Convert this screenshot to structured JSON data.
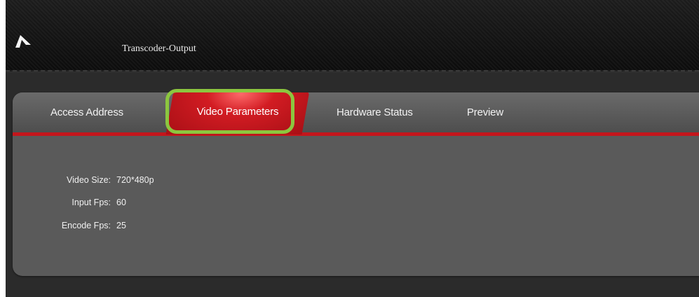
{
  "app": {
    "title": "Transcoder-Output"
  },
  "tabs": [
    {
      "label": "Access Address",
      "active": false
    },
    {
      "label": "Video Parameters",
      "active": true
    },
    {
      "label": "Hardware Status",
      "active": false
    },
    {
      "label": "Preview",
      "active": false
    }
  ],
  "video_parameters": {
    "video_size": {
      "label": "Video Size:",
      "value": "720*480p"
    },
    "input_fps": {
      "label": "Input Fps:",
      "value": "60"
    },
    "encode_fps": {
      "label": "Encode Fps:",
      "value": "25"
    }
  },
  "colors": {
    "active_tab": "#d21c23",
    "highlight_outline": "#8cc63f",
    "panel": "#5a5a5a",
    "header": "#111111"
  }
}
